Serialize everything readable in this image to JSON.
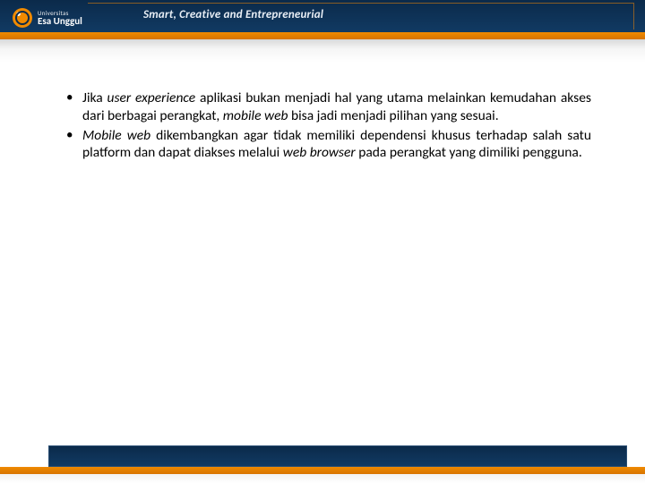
{
  "header": {
    "logo_line1": "Universitas",
    "logo_line2": "Esa Unggul",
    "tagline": "Smart, Creative and Entrepreneurial"
  },
  "content": {
    "bullets": [
      {
        "segments": [
          {
            "text": "Jika ",
            "italic": false
          },
          {
            "text": "user experience",
            "italic": true
          },
          {
            "text": " aplikasi bukan menjadi hal yang utama melainkan kemudahan akses dari berbagai perangkat, ",
            "italic": false
          },
          {
            "text": "mobile web",
            "italic": true
          },
          {
            "text": " bisa jadi menjadi pilihan yang sesuai.",
            "italic": false
          }
        ]
      },
      {
        "segments": [
          {
            "text": "Mobile web",
            "italic": true
          },
          {
            "text": " dikembangkan agar tidak memiliki dependensi khusus terhadap salah satu platform dan dapat diakses melalui ",
            "italic": false
          },
          {
            "text": "web browser",
            "italic": true
          },
          {
            "text": " pada perangkat yang dimiliki pengguna.",
            "italic": false
          }
        ]
      }
    ]
  }
}
